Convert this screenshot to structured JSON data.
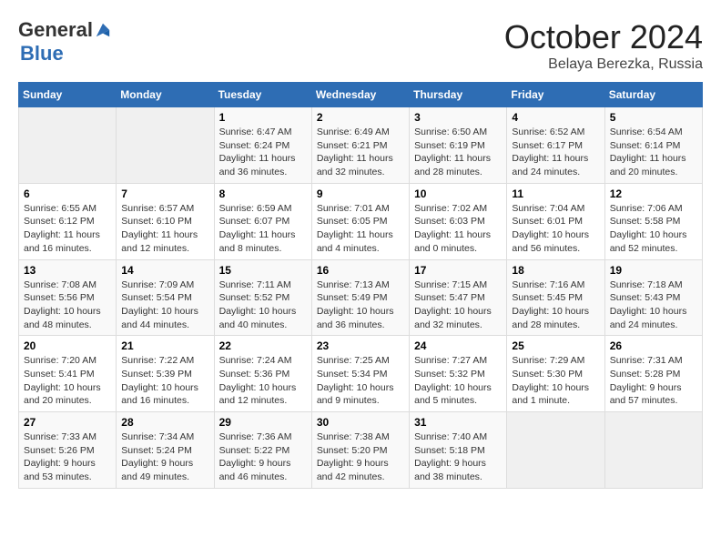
{
  "logo": {
    "general": "General",
    "blue": "Blue"
  },
  "title": "October 2024",
  "subtitle": "Belaya Berezka, Russia",
  "headers": [
    "Sunday",
    "Monday",
    "Tuesday",
    "Wednesday",
    "Thursday",
    "Friday",
    "Saturday"
  ],
  "weeks": [
    [
      {
        "day": "",
        "empty": true
      },
      {
        "day": "",
        "empty": true
      },
      {
        "day": "1",
        "sunrise": "Sunrise: 6:47 AM",
        "sunset": "Sunset: 6:24 PM",
        "daylight": "Daylight: 11 hours and 36 minutes."
      },
      {
        "day": "2",
        "sunrise": "Sunrise: 6:49 AM",
        "sunset": "Sunset: 6:21 PM",
        "daylight": "Daylight: 11 hours and 32 minutes."
      },
      {
        "day": "3",
        "sunrise": "Sunrise: 6:50 AM",
        "sunset": "Sunset: 6:19 PM",
        "daylight": "Daylight: 11 hours and 28 minutes."
      },
      {
        "day": "4",
        "sunrise": "Sunrise: 6:52 AM",
        "sunset": "Sunset: 6:17 PM",
        "daylight": "Daylight: 11 hours and 24 minutes."
      },
      {
        "day": "5",
        "sunrise": "Sunrise: 6:54 AM",
        "sunset": "Sunset: 6:14 PM",
        "daylight": "Daylight: 11 hours and 20 minutes."
      }
    ],
    [
      {
        "day": "6",
        "sunrise": "Sunrise: 6:55 AM",
        "sunset": "Sunset: 6:12 PM",
        "daylight": "Daylight: 11 hours and 16 minutes."
      },
      {
        "day": "7",
        "sunrise": "Sunrise: 6:57 AM",
        "sunset": "Sunset: 6:10 PM",
        "daylight": "Daylight: 11 hours and 12 minutes."
      },
      {
        "day": "8",
        "sunrise": "Sunrise: 6:59 AM",
        "sunset": "Sunset: 6:07 PM",
        "daylight": "Daylight: 11 hours and 8 minutes."
      },
      {
        "day": "9",
        "sunrise": "Sunrise: 7:01 AM",
        "sunset": "Sunset: 6:05 PM",
        "daylight": "Daylight: 11 hours and 4 minutes."
      },
      {
        "day": "10",
        "sunrise": "Sunrise: 7:02 AM",
        "sunset": "Sunset: 6:03 PM",
        "daylight": "Daylight: 11 hours and 0 minutes."
      },
      {
        "day": "11",
        "sunrise": "Sunrise: 7:04 AM",
        "sunset": "Sunset: 6:01 PM",
        "daylight": "Daylight: 10 hours and 56 minutes."
      },
      {
        "day": "12",
        "sunrise": "Sunrise: 7:06 AM",
        "sunset": "Sunset: 5:58 PM",
        "daylight": "Daylight: 10 hours and 52 minutes."
      }
    ],
    [
      {
        "day": "13",
        "sunrise": "Sunrise: 7:08 AM",
        "sunset": "Sunset: 5:56 PM",
        "daylight": "Daylight: 10 hours and 48 minutes."
      },
      {
        "day": "14",
        "sunrise": "Sunrise: 7:09 AM",
        "sunset": "Sunset: 5:54 PM",
        "daylight": "Daylight: 10 hours and 44 minutes."
      },
      {
        "day": "15",
        "sunrise": "Sunrise: 7:11 AM",
        "sunset": "Sunset: 5:52 PM",
        "daylight": "Daylight: 10 hours and 40 minutes."
      },
      {
        "day": "16",
        "sunrise": "Sunrise: 7:13 AM",
        "sunset": "Sunset: 5:49 PM",
        "daylight": "Daylight: 10 hours and 36 minutes."
      },
      {
        "day": "17",
        "sunrise": "Sunrise: 7:15 AM",
        "sunset": "Sunset: 5:47 PM",
        "daylight": "Daylight: 10 hours and 32 minutes."
      },
      {
        "day": "18",
        "sunrise": "Sunrise: 7:16 AM",
        "sunset": "Sunset: 5:45 PM",
        "daylight": "Daylight: 10 hours and 28 minutes."
      },
      {
        "day": "19",
        "sunrise": "Sunrise: 7:18 AM",
        "sunset": "Sunset: 5:43 PM",
        "daylight": "Daylight: 10 hours and 24 minutes."
      }
    ],
    [
      {
        "day": "20",
        "sunrise": "Sunrise: 7:20 AM",
        "sunset": "Sunset: 5:41 PM",
        "daylight": "Daylight: 10 hours and 20 minutes."
      },
      {
        "day": "21",
        "sunrise": "Sunrise: 7:22 AM",
        "sunset": "Sunset: 5:39 PM",
        "daylight": "Daylight: 10 hours and 16 minutes."
      },
      {
        "day": "22",
        "sunrise": "Sunrise: 7:24 AM",
        "sunset": "Sunset: 5:36 PM",
        "daylight": "Daylight: 10 hours and 12 minutes."
      },
      {
        "day": "23",
        "sunrise": "Sunrise: 7:25 AM",
        "sunset": "Sunset: 5:34 PM",
        "daylight": "Daylight: 10 hours and 9 minutes."
      },
      {
        "day": "24",
        "sunrise": "Sunrise: 7:27 AM",
        "sunset": "Sunset: 5:32 PM",
        "daylight": "Daylight: 10 hours and 5 minutes."
      },
      {
        "day": "25",
        "sunrise": "Sunrise: 7:29 AM",
        "sunset": "Sunset: 5:30 PM",
        "daylight": "Daylight: 10 hours and 1 minute."
      },
      {
        "day": "26",
        "sunrise": "Sunrise: 7:31 AM",
        "sunset": "Sunset: 5:28 PM",
        "daylight": "Daylight: 9 hours and 57 minutes."
      }
    ],
    [
      {
        "day": "27",
        "sunrise": "Sunrise: 7:33 AM",
        "sunset": "Sunset: 5:26 PM",
        "daylight": "Daylight: 9 hours and 53 minutes."
      },
      {
        "day": "28",
        "sunrise": "Sunrise: 7:34 AM",
        "sunset": "Sunset: 5:24 PM",
        "daylight": "Daylight: 9 hours and 49 minutes."
      },
      {
        "day": "29",
        "sunrise": "Sunrise: 7:36 AM",
        "sunset": "Sunset: 5:22 PM",
        "daylight": "Daylight: 9 hours and 46 minutes."
      },
      {
        "day": "30",
        "sunrise": "Sunrise: 7:38 AM",
        "sunset": "Sunset: 5:20 PM",
        "daylight": "Daylight: 9 hours and 42 minutes."
      },
      {
        "day": "31",
        "sunrise": "Sunrise: 7:40 AM",
        "sunset": "Sunset: 5:18 PM",
        "daylight": "Daylight: 9 hours and 38 minutes."
      },
      {
        "day": "",
        "empty": true
      },
      {
        "day": "",
        "empty": true
      }
    ]
  ]
}
